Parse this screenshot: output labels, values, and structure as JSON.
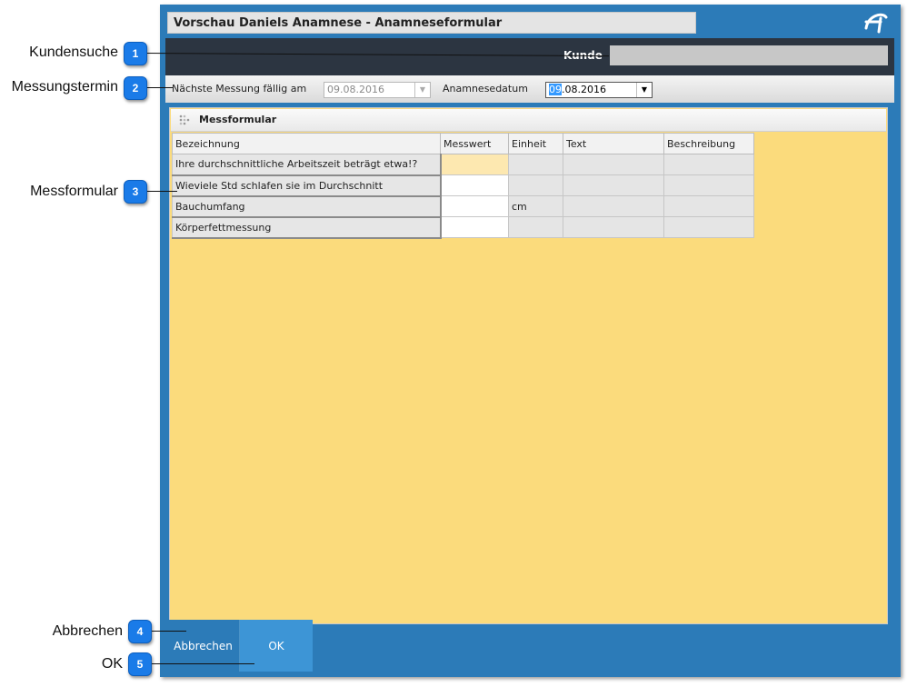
{
  "callouts": [
    {
      "number": "1",
      "label": "Kundensuche"
    },
    {
      "number": "2",
      "label": "Messungstermin"
    },
    {
      "number": "3",
      "label": "Messformular"
    },
    {
      "number": "4",
      "label": "Abbrechen"
    },
    {
      "number": "5",
      "label": "OK"
    }
  ],
  "window": {
    "title": "Vorschau Daniels Anamnese - Anamneseformular",
    "logo_icon": "app-logo-icon"
  },
  "customer": {
    "label": "Kunde",
    "value": ""
  },
  "dates": {
    "next_label": "Nächste Messung fällig am",
    "next_value": "09.08.2016",
    "anamnesis_label": "Anamnesedatum",
    "anamnesis_value_selected": "09",
    "anamnesis_value_rest": ".08.2016"
  },
  "form": {
    "title": "Messformular",
    "columns": [
      "Bezeichnung",
      "Messwert",
      "Einheit",
      "Text",
      "Beschreibung"
    ],
    "rows": [
      {
        "bezeichnung": "Ihre durchschnittliche Arbeitszeit beträgt etwa!?",
        "messwert": "",
        "einheit": "",
        "text": "",
        "beschreibung": ""
      },
      {
        "bezeichnung": "Wieviele Std schlafen sie im Durchschnitt",
        "messwert": "",
        "einheit": "",
        "text": "",
        "beschreibung": ""
      },
      {
        "bezeichnung": "Bauchumfang",
        "messwert": "",
        "einheit": "cm",
        "text": "",
        "beschreibung": ""
      },
      {
        "bezeichnung": "Körperfettmessung",
        "messwert": "",
        "einheit": "",
        "text": "",
        "beschreibung": ""
      }
    ]
  },
  "buttons": {
    "cancel": "Abbrechen",
    "ok": "OK"
  },
  "colors": {
    "accent": "#2c7bb8",
    "badge": "#1a7be8",
    "form_background": "#fbdb7c",
    "ok_button": "#3d95d6"
  }
}
